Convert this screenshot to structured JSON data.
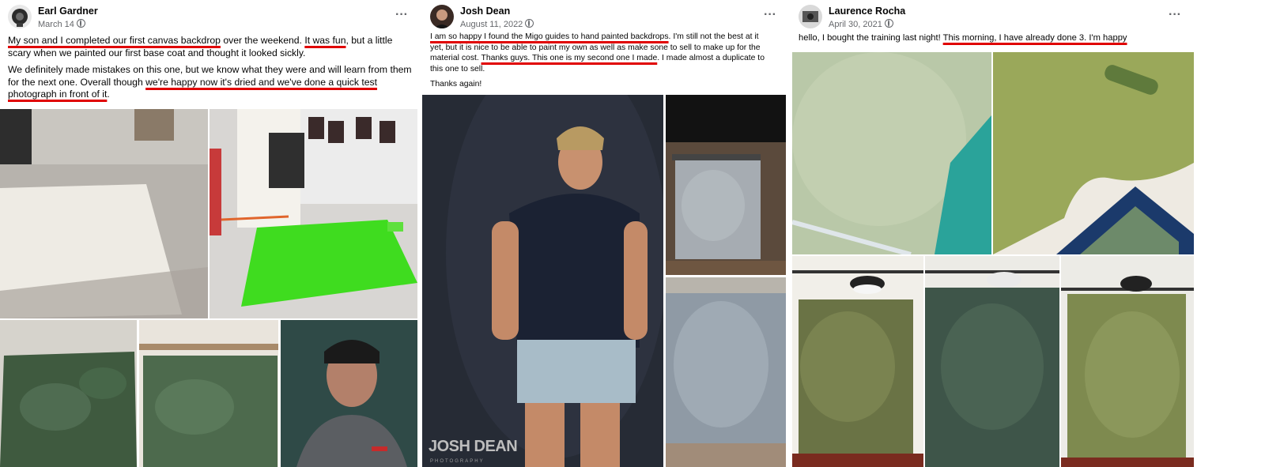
{
  "posts": [
    {
      "author": "Earl Gardner",
      "date": "March 14",
      "paragraph1": [
        {
          "t": "My son and I completed our first canvas backdrop",
          "u": true
        },
        {
          "t": " over the weekend. ",
          "u": false
        },
        {
          "t": "It was fun",
          "u": true
        },
        {
          "t": ", but a little scary when we painted our first base coat and thought it looked sickly.",
          "u": false
        }
      ],
      "paragraph2": [
        {
          "t": "We definitely made mistakes on this one, but we know what they were and will learn from them for the next one. Overall though ",
          "u": false
        },
        {
          "t": "we're happy now it's dried and we've done a quick test photograph in front of it",
          "u": true
        },
        {
          "t": ".",
          "u": false
        }
      ]
    },
    {
      "author": "Josh Dean",
      "date": "August 11, 2022",
      "paragraph1": [
        {
          "t": "I am so happy I found the Migo guides to hand painted backdrops",
          "u": true
        },
        {
          "t": ". I'm still not the best at it yet, but it is nice to be able to paint my own as well as make sone to sell to make up for the material cost. ",
          "u": false
        },
        {
          "t": "Thanks guys. This one is my second one I made",
          "u": true
        },
        {
          "t": ". I made almost a duplicate to this one to sell.",
          "u": false
        }
      ],
      "paragraph2": [
        {
          "t": "Thanks again!",
          "u": false
        }
      ],
      "watermark": "JOSH DEAN",
      "watermark_sub": "PHOTOGRAPHY"
    },
    {
      "author": "Laurence Rocha",
      "date": "April 30, 2021",
      "paragraph1": [
        {
          "t": "hello, I bought the training last night!  ",
          "u": false
        },
        {
          "t": "This morning, I have already done 3.  I'm happy",
          "u": true
        }
      ],
      "paragraph2": []
    }
  ],
  "more_icon": "more-horizontal-icon",
  "globe_icon": "globe-icon",
  "accent_underline": "#e00000"
}
